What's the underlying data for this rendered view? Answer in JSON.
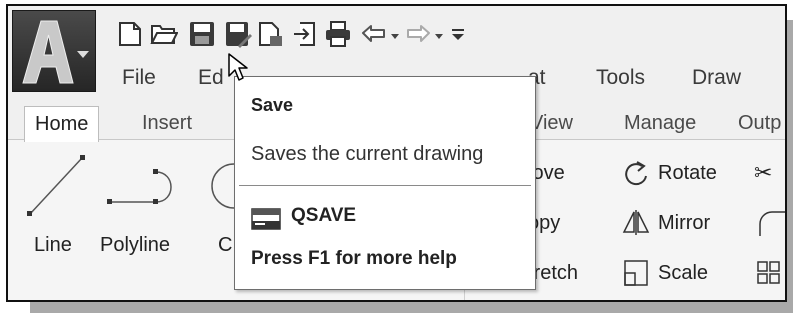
{
  "app_button": {
    "letter": "A",
    "icon": "autocad-logo-icon"
  },
  "quick_access_toolbar": {
    "icons": [
      "new-icon",
      "open-icon",
      "save-icon",
      "save-as-icon",
      "export-icon",
      "import-icon",
      "print-icon",
      "undo-icon",
      "dropdown-icon",
      "redo-icon",
      "dropdown-icon",
      "customize-icon"
    ]
  },
  "menu_bar": {
    "items": [
      {
        "label": "File"
      },
      {
        "label": "Ed"
      },
      {
        "label": "at"
      },
      {
        "label": "Tools"
      },
      {
        "label": "Draw"
      }
    ]
  },
  "ribbon_tabs": [
    {
      "label": "Home",
      "active": true
    },
    {
      "label": "Insert"
    },
    {
      "label": "View"
    },
    {
      "label": "Manage"
    },
    {
      "label": "Outp"
    }
  ],
  "draw_panel": {
    "tools": [
      {
        "label": "Line",
        "icon": "line-icon"
      },
      {
        "label": "Polyline",
        "icon": "polyline-icon"
      },
      {
        "label": "C",
        "icon": "circle-icon"
      }
    ]
  },
  "modify_panel": {
    "tools": [
      {
        "label": "love",
        "icon": ""
      },
      {
        "label": "Rotate",
        "icon": "rotate-icon"
      },
      {
        "label": "opy",
        "icon": ""
      },
      {
        "label": "Mirror",
        "icon": "mirror-icon"
      },
      {
        "label": "tretch",
        "icon": ""
      },
      {
        "label": "Scale",
        "icon": "scale-icon"
      }
    ]
  },
  "tooltip": {
    "title": "Save",
    "description": "Saves the current drawing",
    "command": "QSAVE",
    "help": "Press F1 for more help"
  },
  "colors": {
    "accent": "#333333",
    "tooltip_border": "#6e6e6e",
    "app_button": "#2e2e2e"
  }
}
